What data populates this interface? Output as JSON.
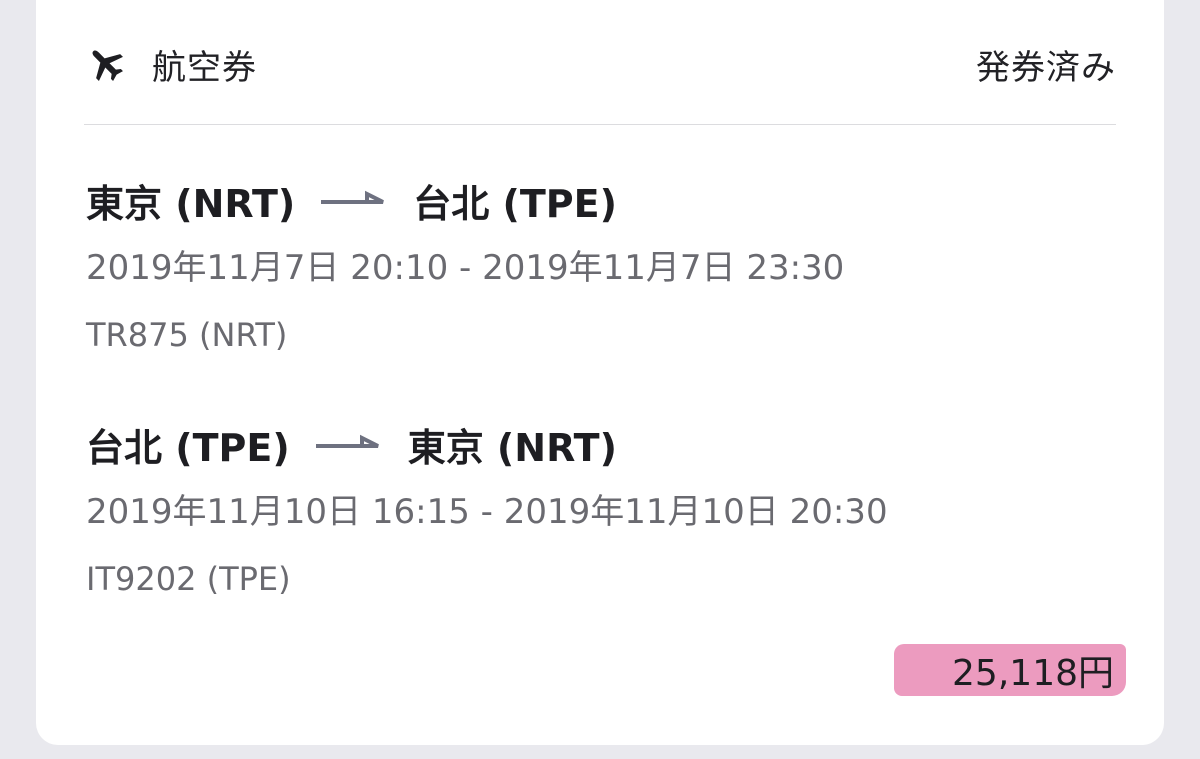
{
  "header": {
    "icon": "airplane-icon",
    "title": "航空券",
    "status": "発券済み"
  },
  "segments": [
    {
      "from": "東京 (NRT)",
      "to": "台北 (TPE)",
      "times": "2019年11月7日 20:10 - 2019年11月7日 23:30",
      "flight": "TR875 (NRT)"
    },
    {
      "from": "台北 (TPE)",
      "to": "東京 (NRT)",
      "times": "2019年11月10日 16:15 - 2019年11月10日 20:30",
      "flight": "IT9202 (TPE)"
    }
  ],
  "price": "25,118円",
  "colors": {
    "highlight": "#ec9bbf",
    "arrow": "#6e7180",
    "text_secondary": "#6a6a70"
  }
}
